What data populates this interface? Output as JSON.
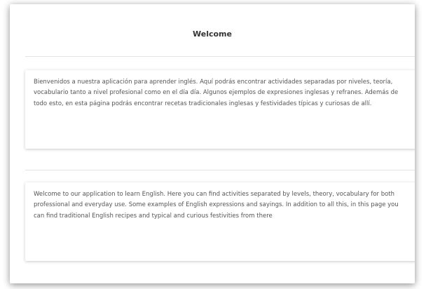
{
  "page": {
    "title": "Welcome"
  },
  "cards": [
    {
      "text": "Bienvenidos a nuestra aplicación para aprender inglés. Aquí podrás encontrar actividades separadas por niveles, teoría, vocabulario tanto a nivel profesional como en el día día. Algunos ejemplos de expresiones inglesas y refranes. Además de todo esto, en esta página podrás encontrar recetas tradicionales inglesas y festividades típicas y curiosas de allí."
    },
    {
      "text": "Welcome to our application to learn English. Here you can find activities separated by levels, theory, vocabulary for both professional and everyday use. Some examples of English expressions and sayings. In addition to all this, in this page you can find traditional English recipes and typical and curious festivities from there"
    }
  ]
}
